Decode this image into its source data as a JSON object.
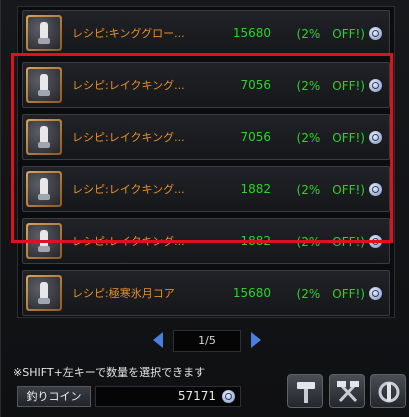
{
  "items": [
    {
      "name": "レシピ:キンググロー...",
      "price": "15680",
      "discount": "(2%　OFF!)"
    },
    {
      "name": "レシピ:レイクキング...",
      "price": "7056",
      "discount": "(2%　OFF!)"
    },
    {
      "name": "レシピ:レイクキング...",
      "price": "7056",
      "discount": "(2%　OFF!)"
    },
    {
      "name": "レシピ:レイクキング...",
      "price": "1882",
      "discount": "(2%　OFF!)"
    },
    {
      "name": "レシピ:レイクキング...",
      "price": "1882",
      "discount": "(2%　OFF!)"
    },
    {
      "name": "レシピ:極寒氷月コア",
      "price": "15680",
      "discount": "(2%　OFF!)"
    }
  ],
  "pager": {
    "page": "1/5"
  },
  "hint": "※SHIFT+左キーで数量を選択できます",
  "currency": {
    "label": "釣りコイン",
    "value": "57171"
  },
  "colors": {
    "item_name": "#e8902a",
    "price": "#2fd12f",
    "highlight": "#e01020"
  },
  "icons": {
    "item": "scroll-recipe-icon",
    "detail": "magnifier-icon",
    "tools": [
      "hammer-icon",
      "crossed-hammers-icon",
      "repair-icon"
    ]
  }
}
